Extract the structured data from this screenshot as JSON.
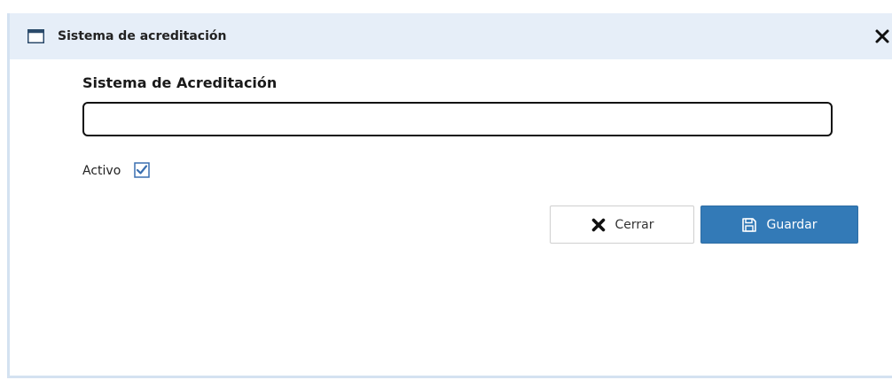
{
  "dialog": {
    "title": "Sistema de acreditación",
    "icon": "window-icon",
    "close_icon": "close-icon"
  },
  "form": {
    "field_label": "Sistema de Acreditación",
    "field_value": "",
    "active_label": "Activo",
    "active_checked": true
  },
  "buttons": {
    "close_label": "Cerrar",
    "close_icon": "close-icon",
    "save_label": "Guardar",
    "save_icon": "save-icon"
  },
  "colors": {
    "title_bar": "#e6eef8",
    "primary": "#337ab7",
    "checkbox": "#3a6fb0"
  }
}
